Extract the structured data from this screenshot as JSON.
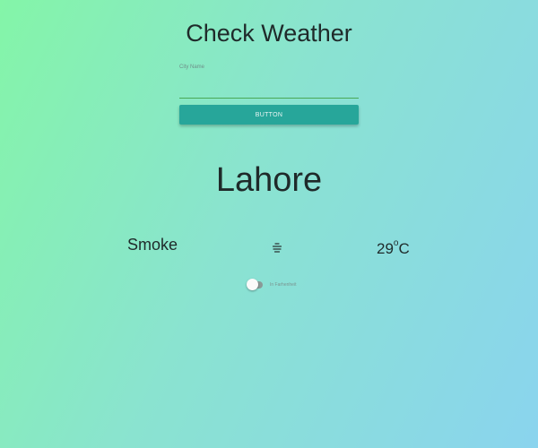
{
  "header": {
    "title": "Check Weather"
  },
  "search": {
    "label": "City Name",
    "value": "",
    "button_label": "BUTTON"
  },
  "weather": {
    "city": "Lahore",
    "condition": "Smoke",
    "condition_icon": "haze-icon",
    "temperature": "29",
    "unit_degree": "o",
    "unit": "C"
  },
  "toggle": {
    "label": "In Farhenheit",
    "checked": false
  },
  "colors": {
    "accent": "#27a69a",
    "input_underline": "#49a856",
    "gradient_start": "#84f5a8",
    "gradient_end": "#8ad4ee"
  }
}
